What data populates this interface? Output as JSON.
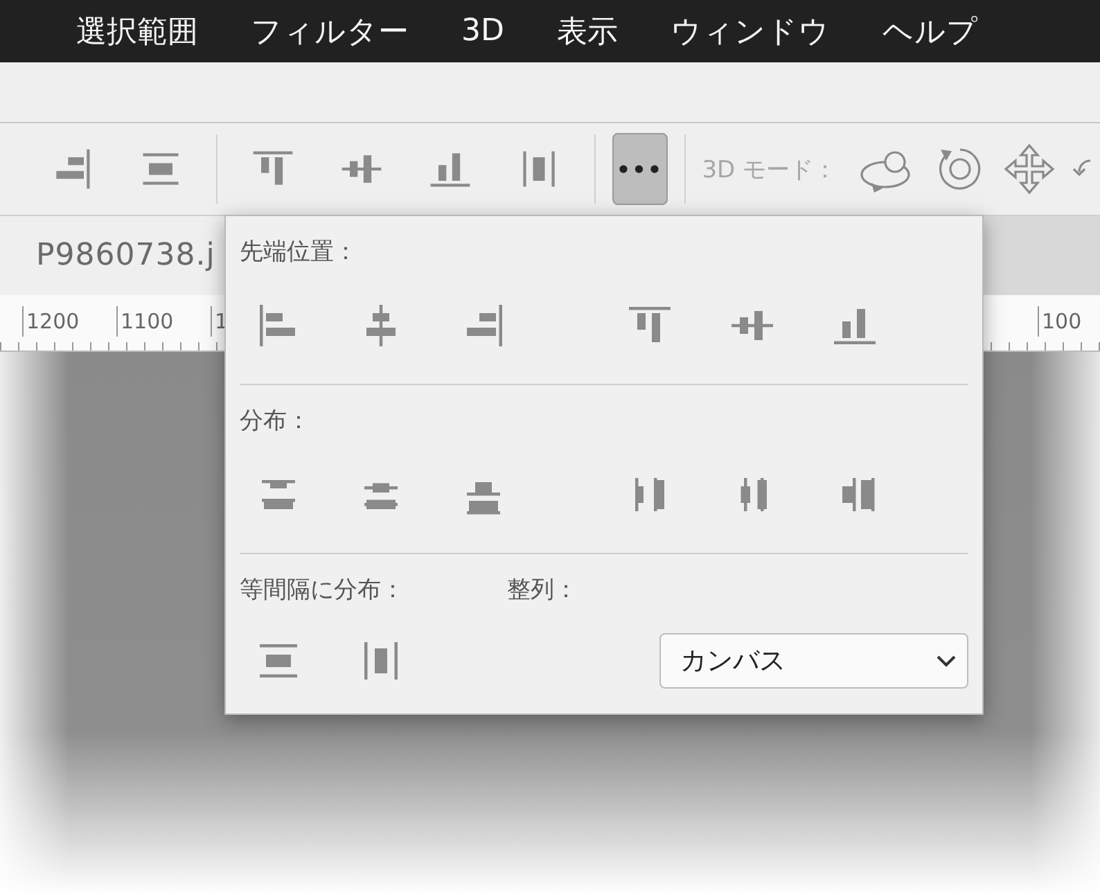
{
  "menu_bar": {
    "items": [
      "選択範囲",
      "フィルター",
      "3D",
      "表示",
      "ウィンドウ",
      "ヘルプ"
    ]
  },
  "toolbar": {
    "items": [
      {
        "kind": "align-right"
      },
      {
        "kind": "space-v"
      },
      {
        "kind": "separator"
      },
      {
        "kind": "align-top"
      },
      {
        "kind": "align-vcenter"
      },
      {
        "kind": "align-bottom"
      },
      {
        "kind": "space-h"
      },
      {
        "kind": "separator"
      },
      {
        "kind": "more",
        "label": "•••",
        "selected": true
      },
      {
        "kind": "separator"
      },
      {
        "kind": "label",
        "label": "3D モード："
      },
      {
        "kind": "orbit"
      },
      {
        "kind": "roll"
      },
      {
        "kind": "pan"
      },
      {
        "kind": "slide"
      }
    ]
  },
  "document_tab": {
    "title": "P9860738.j"
  },
  "ruler": {
    "left_labels": [
      "1200",
      "1100",
      "1"
    ],
    "right_labels": [
      "100"
    ]
  },
  "popover": {
    "alignment": {
      "title": "先端位置：",
      "groups": [
        [
          {
            "kind": "align-left"
          },
          {
            "kind": "align-hcenter"
          },
          {
            "kind": "align-right"
          }
        ],
        [
          {
            "kind": "align-top"
          },
          {
            "kind": "align-vcenter"
          },
          {
            "kind": "align-bottom"
          }
        ]
      ]
    },
    "distribute": {
      "title": "分布：",
      "groups": [
        [
          {
            "kind": "dist-top"
          },
          {
            "kind": "dist-vcenter"
          },
          {
            "kind": "dist-bottom"
          }
        ],
        [
          {
            "kind": "dist-left"
          },
          {
            "kind": "dist-hcenter"
          },
          {
            "kind": "dist-right"
          }
        ]
      ]
    },
    "spacing": {
      "title": "等間隔に分布：",
      "buttons": [
        {
          "kind": "space-v"
        },
        {
          "kind": "space-h"
        }
      ]
    },
    "align_to": {
      "title": "整列：",
      "value": "カンバス"
    }
  }
}
